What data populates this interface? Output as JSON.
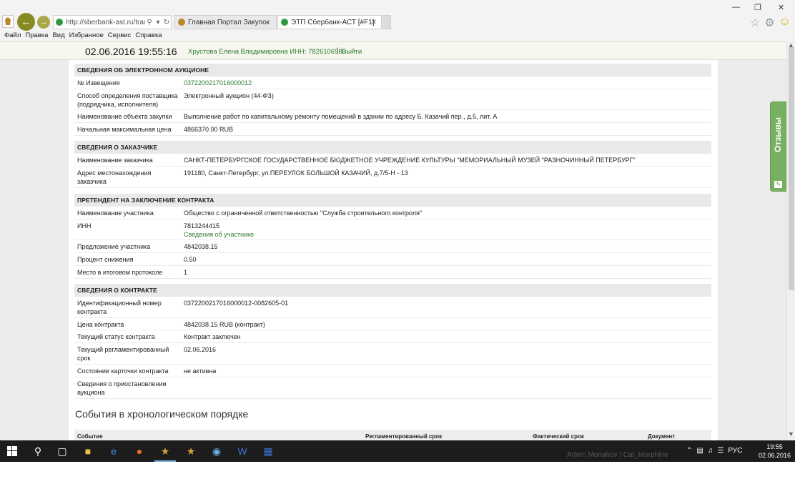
{
  "browser": {
    "url": "http://sberbank-ast.ru/trad",
    "tabs": [
      {
        "label": "Главная Портал Закупок"
      },
      {
        "label": "ЭТП Сбербанк-АСТ [#F1]"
      }
    ],
    "menu": [
      "Файл",
      "Правка",
      "Вид",
      "Избранное",
      "Сервис",
      "Справка"
    ]
  },
  "header": {
    "date": "02.06.2016",
    "time": "19:55:16",
    "user": "Хрустова Елена Владимировна ИНН: 7826106980",
    "separator": "|",
    "logout": "Выйти"
  },
  "auction": {
    "title": "СВЕДЕНИЯ ОБ ЭЛЕКТРОННОМ АУКЦИОНЕ",
    "rows": [
      {
        "label": "№ Извещения",
        "value": "0372200217016000012"
      },
      {
        "label": "Способ определения поставщика (подрядчика, исполнителя)",
        "value": "Электронный аукцион (44-ФЗ)"
      },
      {
        "label": "Наименование объекта закупки",
        "value": "Выполнение работ по капитальному ремонту помещений в здании по адресу Б. Казачий пер., д.5, лит. А"
      },
      {
        "label": "Начальная максимальная цена",
        "value": "4866370.00  RUB"
      }
    ]
  },
  "customer": {
    "title": "СВЕДЕНИЯ О ЗАКАЗЧИКЕ",
    "rows": [
      {
        "label": "Наименование заказчика",
        "value": "САНКТ-ПЕТЕРБУРГСКОЕ ГОСУДАРСТВЕННОЕ БЮДЖЕТНОЕ УЧРЕЖДЕНИЕ КУЛЬТУРЫ \"МЕМОРИАЛЬНЫЙ МУЗЕЙ \"РАЗНОЧИННЫЙ ПЕТЕРБУРГ\""
      },
      {
        "label": "Адрес местонахождения заказчика",
        "value": "191180, Санкт-Петербург, ул.ПЕРЕУЛОК БОЛЬШОЙ КАЗАЧИЙ, д.7/5-Н - 13"
      }
    ]
  },
  "applicant": {
    "title": "ПРЕТЕНДЕНТ НА ЗАКЛЮЧЕНИЕ КОНТРАКТА",
    "rows": [
      {
        "label": "Наименование участника",
        "value": "Общество с ограниченной ответственностью \"Служба строительного контроля\""
      },
      {
        "label": "ИНН",
        "value": "7813244415",
        "link": "Сведения об участнике"
      },
      {
        "label": "Предложение участника",
        "value": "4842038.15"
      },
      {
        "label": "Процент снижения",
        "value": "0.50"
      },
      {
        "label": "Место в итоговом протоколе",
        "value": "1"
      }
    ]
  },
  "contract": {
    "title": "СВЕДЕНИЯ О КОНТРАКТЕ",
    "rows": [
      {
        "label": "Идентификационный номер контракта",
        "value": "0372200217016000012-0082605-01"
      },
      {
        "label": "Цена контракта",
        "value": "4842038.15  RUB  (контракт)"
      },
      {
        "label": "Текущий статус контракта",
        "value": "Контракт заключен"
      },
      {
        "label": "Текущий регламентированный срок",
        "value": "02.06.2016"
      },
      {
        "label": "Состояние карточки контракта",
        "value": "не активна"
      },
      {
        "label": "Сведения о приостановлении аукциона",
        "value": ""
      }
    ]
  },
  "events": {
    "title": "События в хронологическом порядке",
    "columns": [
      "Событие",
      "Регламентированный срок",
      "Фактический срок",
      "Документ"
    ]
  },
  "feedback": {
    "label": "Отзывы"
  },
  "taskbar": {
    "watermark": "Artem Monahov | Cat_Morphine",
    "language": "РУС",
    "clock_time": "19:55",
    "clock_date": "02.06.2016"
  },
  "colors": {
    "link": "#2e7d32",
    "section_bg": "#e9e9e9",
    "feedback": "#78b061",
    "nav": "#8a8a24"
  }
}
